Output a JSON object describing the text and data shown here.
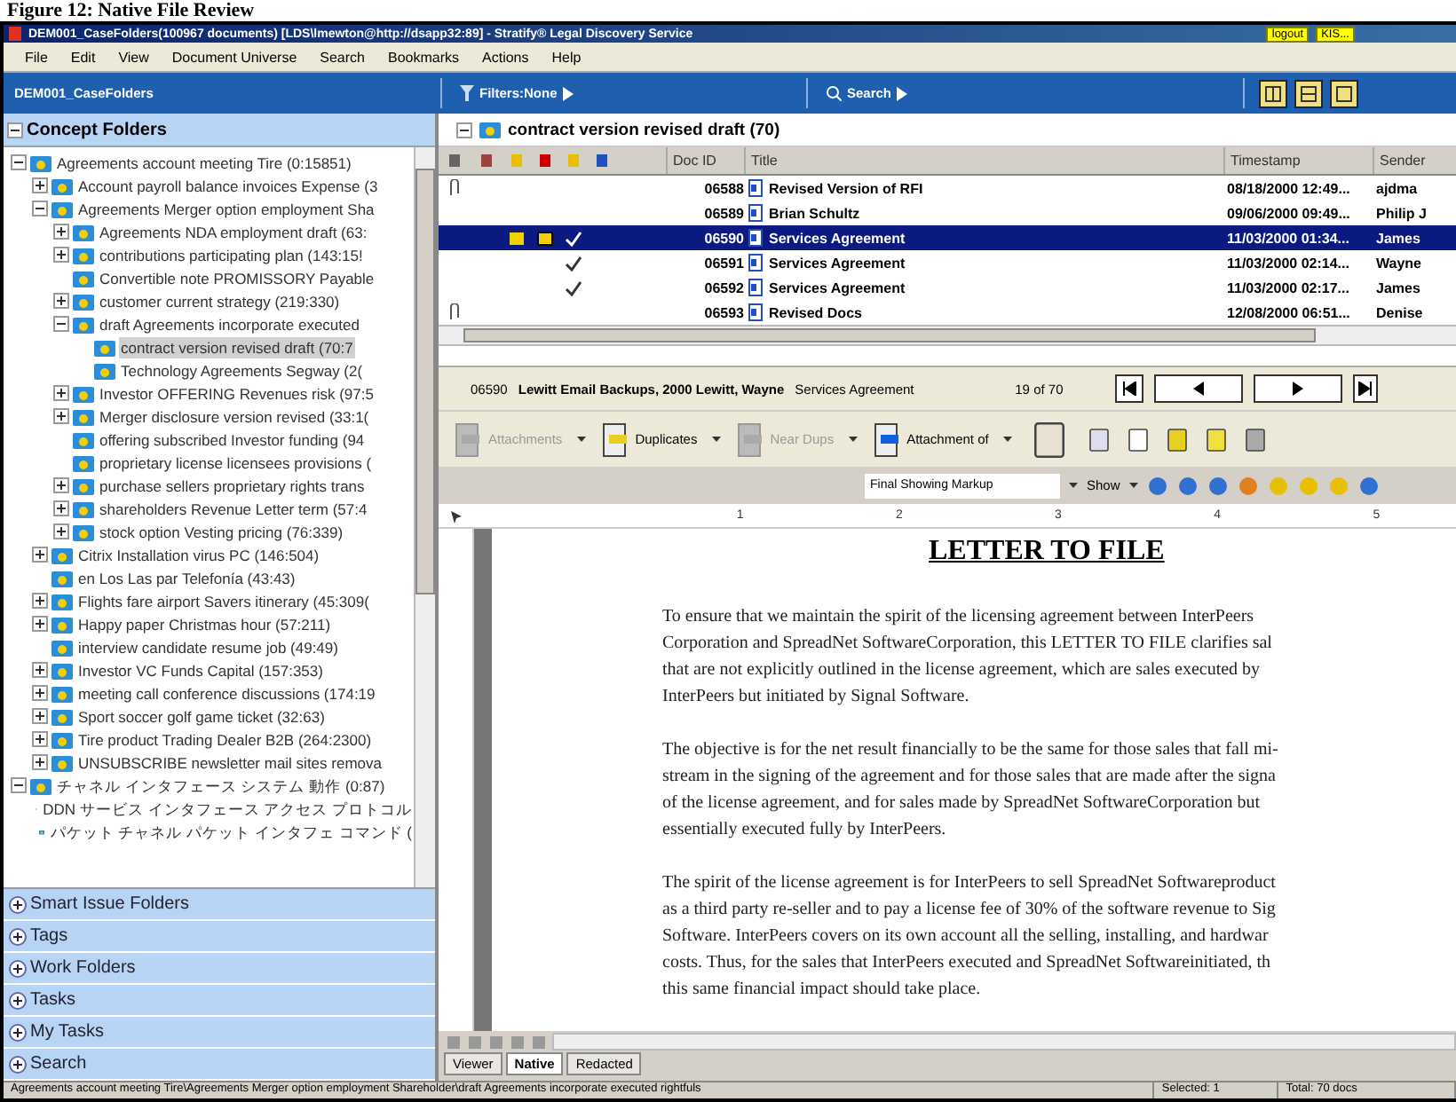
{
  "caption": "Figure 12:  Native File Review",
  "window": {
    "title": "DEM001_CaseFolders(100967 documents) [LDS\\lmewton@http://dsapp32:89] - Stratify® Legal Discovery Service",
    "buttons": [
      "logout",
      "KIS..."
    ]
  },
  "menu": [
    "File",
    "Edit",
    "View",
    "Document Universe",
    "Search",
    "Bookmarks",
    "Actions",
    "Help"
  ],
  "toolbar": {
    "case": "DEM001_CaseFolders",
    "filters": "Filters:None",
    "search": "Search"
  },
  "sidebar": {
    "title": "Concept Folders",
    "expanded": true,
    "tree": [
      {
        "label": "Agreements account meeting Tire (0:15851)",
        "expanded": true,
        "selected": false,
        "children": [
          {
            "label": "Account payroll balance invoices Expense (3",
            "expanded": false,
            "selected": false
          },
          {
            "label": "Agreements Merger option employment Sha",
            "expanded": true,
            "selected": false,
            "children": [
              {
                "label": "Agreements NDA employment draft (63:",
                "expanded": false,
                "selected": false
              },
              {
                "label": "contributions participating plan (143:15!",
                "expanded": false,
                "selected": false
              },
              {
                "label": "Convertible note PROMISSORY Payable",
                "selected": false
              },
              {
                "label": "customer current strategy (219:330)",
                "expanded": false,
                "selected": false
              },
              {
                "label": "draft Agreements incorporate executed",
                "expanded": true,
                "selected": false,
                "children": [
                  {
                    "label": "contract version revised draft (70:7",
                    "selected": true
                  },
                  {
                    "label": "Technology Agreements Segway (2(",
                    "selected": false
                  }
                ]
              },
              {
                "label": "Investor OFFERING Revenues risk (97:5",
                "expanded": false,
                "selected": false
              },
              {
                "label": "Merger disclosure version revised (33:1(",
                "expanded": false,
                "selected": false
              },
              {
                "label": "offering subscribed Investor funding (94",
                "selected": false
              },
              {
                "label": "proprietary license licensees provisions (",
                "selected": false
              },
              {
                "label": "purchase sellers proprietary rights trans",
                "expanded": false,
                "selected": false
              },
              {
                "label": "shareholders Revenue Letter term (57:4",
                "expanded": false,
                "selected": false
              },
              {
                "label": "stock option Vesting pricing (76:339)",
                "expanded": false,
                "selected": false
              }
            ]
          },
          {
            "label": "Citrix Installation virus PC (146:504)",
            "expanded": false,
            "selected": false
          },
          {
            "label": "en Los Las par Telefonía (43:43)",
            "selected": false
          },
          {
            "label": "Flights fare airport Savers itinerary (45:309(",
            "expanded": false,
            "selected": false
          },
          {
            "label": "Happy paper Christmas hour (57:211)",
            "expanded": false,
            "selected": false
          },
          {
            "label": "interview candidate resume job (49:49)",
            "selected": false
          },
          {
            "label": "Investor VC Funds Capital (157:353)",
            "expanded": false,
            "selected": false
          },
          {
            "label": "meeting call conference discussions (174:19",
            "expanded": false,
            "selected": false
          },
          {
            "label": "Sport soccer golf game ticket (32:63)",
            "expanded": false,
            "selected": false
          },
          {
            "label": "Tire product Trading Dealer B2B (264:2300)",
            "expanded": false,
            "selected": false
          },
          {
            "label": "UNSUBSCRIBE newsletter mail sites remova",
            "expanded": false,
            "selected": false
          }
        ]
      },
      {
        "label": "チャネル インタフェース システム 動作 (0:87)",
        "expanded": true,
        "selected": false,
        "children": [
          {
            "label": "DDN サービス インタフェース アクセス プロトコル",
            "selected": false
          },
          {
            "label": "パケット チャネル パケット インタフェ コマンド (",
            "selected": false
          }
        ]
      }
    ],
    "sections": [
      {
        "label": "Smart Issue Folders",
        "expanded": false
      },
      {
        "label": "Tags",
        "expanded": false
      },
      {
        "label": "Work Folders",
        "expanded": false
      },
      {
        "label": "Tasks",
        "expanded": false
      },
      {
        "label": "My Tasks",
        "expanded": false
      },
      {
        "label": "Search",
        "expanded": false
      }
    ]
  },
  "folder": {
    "title": "contract version revised draft (70)",
    "expanded": true
  },
  "table": {
    "columns": [
      "Doc ID",
      "Title",
      "Timestamp",
      "Sender"
    ],
    "rows": [
      {
        "doc_id": "06588",
        "title": "Revised Version of RFI",
        "timestamp": "08/18/2000 12:49...",
        "sender": "ajdma",
        "selected": false,
        "attachment": true,
        "flagged": false,
        "reviewed": false
      },
      {
        "doc_id": "06589",
        "title": "Brian Schultz",
        "timestamp": "09/06/2000 09:49...",
        "sender": "Philip J",
        "selected": false,
        "attachment": false,
        "flagged": false,
        "reviewed": false
      },
      {
        "doc_id": "06590",
        "title": "Services Agreement",
        "timestamp": "11/03/2000 01:34...",
        "sender": "James",
        "selected": true,
        "attachment": false,
        "flagged": true,
        "reviewed": true
      },
      {
        "doc_id": "06591",
        "title": "Services Agreement",
        "timestamp": "11/03/2000 02:14...",
        "sender": "Wayne",
        "selected": false,
        "attachment": false,
        "flagged": false,
        "reviewed": true
      },
      {
        "doc_id": "06592",
        "title": "Services Agreement",
        "timestamp": "11/03/2000 02:17...",
        "sender": "James",
        "selected": false,
        "attachment": false,
        "flagged": false,
        "reviewed": true
      },
      {
        "doc_id": "06593",
        "title": "Revised Docs",
        "timestamp": "12/08/2000 06:51...",
        "sender": "Denise",
        "selected": false,
        "attachment": true,
        "flagged": false,
        "reviewed": false
      }
    ]
  },
  "info": {
    "doc_id": "06590",
    "custodian": "Lewitt Email Backups, 2000 Lewitt, Wayne",
    "title": "Services Agreement",
    "position": "19 of 70"
  },
  "actions": [
    {
      "label": "Attachments",
      "disabled": true
    },
    {
      "label": "Duplicates",
      "disabled": false
    },
    {
      "label": "Near Dups",
      "disabled": true
    },
    {
      "label": "Attachment of",
      "disabled": false
    }
  ],
  "markup": {
    "mode": "Final Showing Markup",
    "show": "Show"
  },
  "ruler": [
    "1",
    "2",
    "3",
    "4",
    "5"
  ],
  "document": {
    "heading": "LETTER TO FILE",
    "paragraphs": [
      [
        "To ensure that we maintain the spirit of the licensing agreement between InterPeers",
        "Corporation and SpreadNet SoftwareCorporation, this LETTER TO FILE clarifies sal",
        "that are not explicitly outlined in the license agreement, which are sales executed by",
        "InterPeers but initiated by Signal Software."
      ],
      [
        "The objective is for the net result financially to be the same for those sales that fall mi-",
        "stream in the signing of the agreement and for those sales that are made after the signa",
        "of the license agreement, and for sales made by SpreadNet SoftwareCorporation but",
        "essentially executed fully by InterPeers."
      ],
      [
        "The spirit of the license agreement is for InterPeers to sell SpreadNet Softwareproduct",
        "as a third party re-seller and to pay a license fee of 30% of the software revenue to Sig",
        "Software.  InterPeers covers on its own account all the selling, installing, and hardwar",
        "costs.  Thus, for the sales that InterPeers executed and SpreadNet Softwareinitiated, th",
        "this same financial impact should take place."
      ]
    ]
  },
  "view_tabs": [
    {
      "label": "Viewer",
      "selected": false
    },
    {
      "label": "Native",
      "selected": true
    },
    {
      "label": "Redacted",
      "selected": false
    }
  ],
  "status_bar": [
    "Agreements account meeting Tire\\Agreements Merger option employment Shareholder\\draft Agreements incorporate executed rightfuls",
    "Selected: 1",
    "Total: 70 docs"
  ]
}
